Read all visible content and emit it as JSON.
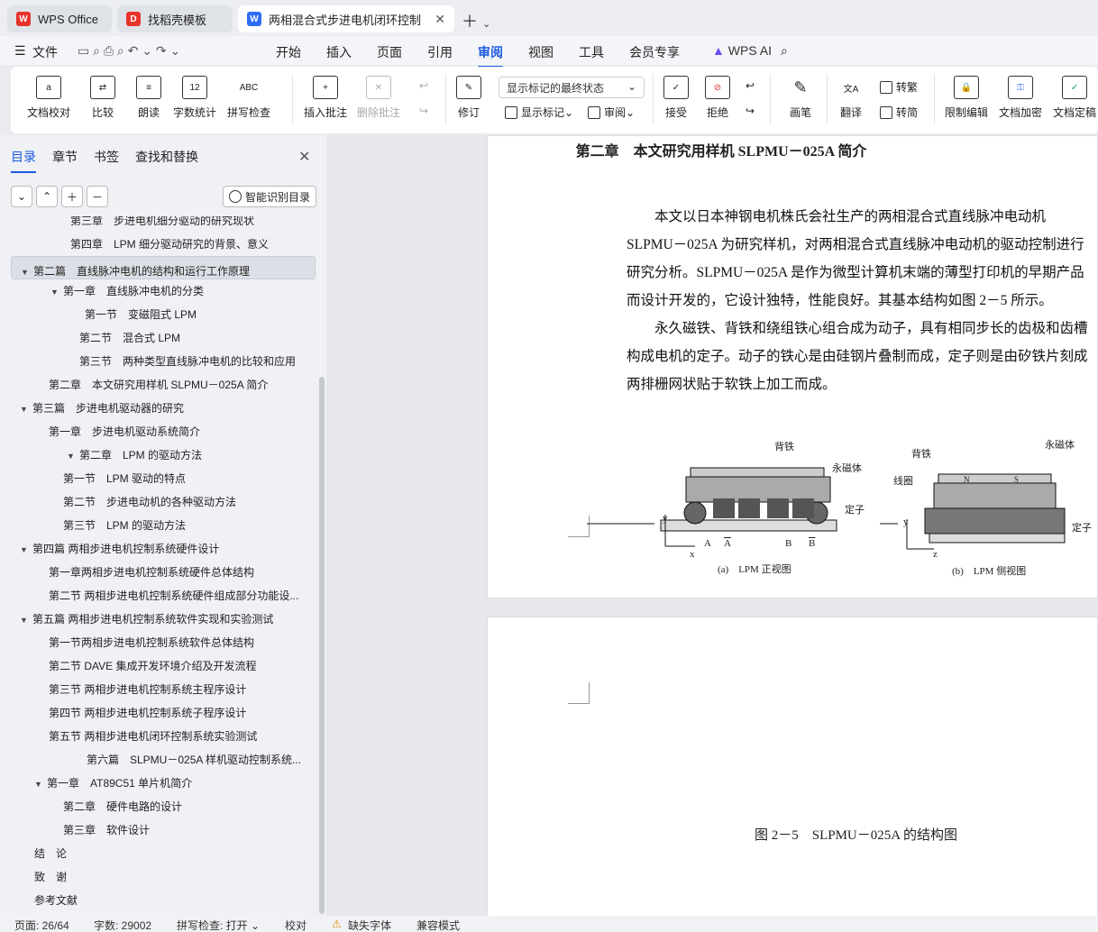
{
  "tabs": [
    {
      "label": "WPS Office",
      "icon": "wps-logo-icon"
    },
    {
      "label": "找稻壳模板",
      "icon": "docer-icon"
    },
    {
      "label": "两相混合式步进电机闭环控制系",
      "icon": "word-doc-icon"
    }
  ],
  "menu": {
    "file": "文件",
    "items": [
      "开始",
      "插入",
      "页面",
      "引用",
      "审阅",
      "视图",
      "工具",
      "会员专享"
    ],
    "active": "审阅",
    "ai": "WPS AI"
  },
  "ribbon": {
    "buttons": [
      "文档校对",
      "比较",
      "朗读",
      "字数统计",
      "拼写检查",
      "插入批注",
      "删除批注",
      "修订",
      "接受",
      "拒绝",
      "画笔",
      "限制编辑",
      "文档加密",
      "文档定稿"
    ],
    "markup_select": "显示标记的最终状态",
    "show_markup": "显示标记",
    "review": "审阅",
    "translate": "翻译",
    "to_traditional": "转繁",
    "to_simplified": "转简",
    "abc": "ABC",
    "count_glyph": "12"
  },
  "sidebar": {
    "tabs": [
      "目录",
      "章节",
      "书签",
      "查找和替换"
    ],
    "smart_label": "智能识别目录",
    "toc": [
      {
        "text": "第三章　步进电机细分驱动的研究现状",
        "indent": 78,
        "arrow": ""
      },
      {
        "text": "第四章　LPM 细分驱动研究的背景、意义",
        "indent": 78,
        "arrow": ""
      },
      {
        "text": "第二篇　直线脉冲电机的结构和运行工作原理",
        "indent": 38,
        "arrow": "▼",
        "selected": true
      },
      {
        "text": "第一章　直线脉冲电机的分类",
        "indent": 72,
        "arrow": "▼"
      },
      {
        "text": "第一节　变磁阻式 LPM",
        "indent": 94,
        "arrow": ""
      },
      {
        "text": "第二节　混合式 LPM",
        "indent": 88,
        "arrow": ""
      },
      {
        "text": "第三节　两种类型直线脉冲电机的比较和应用",
        "indent": 88,
        "arrow": ""
      },
      {
        "text": "第二章　本文研究用样机 SLPMU－025A 简介",
        "indent": 54,
        "arrow": ""
      },
      {
        "text": "第三篇　步进电机驱动器的研究",
        "indent": 38,
        "arrow": "▼"
      },
      {
        "text": "第一章　步进电机驱动系统简介",
        "indent": 54,
        "arrow": ""
      },
      {
        "text": "第二章　LPM 的驱动方法",
        "indent": 90,
        "arrow": "▼"
      },
      {
        "text": "第一节　LPM 驱动的特点",
        "indent": 70,
        "arrow": ""
      },
      {
        "text": "第二节　步进电动机的各种驱动方法",
        "indent": 70,
        "arrow": ""
      },
      {
        "text": "第三节　LPM 的驱动方法",
        "indent": 70,
        "arrow": ""
      },
      {
        "text": "第四篇  两相步进电机控制系统硬件设计",
        "indent": 38,
        "arrow": "▼"
      },
      {
        "text": "第一章两相步进电机控制系统硬件总体结构",
        "indent": 54,
        "arrow": ""
      },
      {
        "text": "第二节  两相步进电机控制系统硬件组成部分功能设...",
        "indent": 54,
        "arrow": ""
      },
      {
        "text": "第五篇  两相步进电机控制系统软件实现和实验测试",
        "indent": 38,
        "arrow": "▼"
      },
      {
        "text": "第一节两相步进电机控制系统软件总体结构",
        "indent": 54,
        "arrow": ""
      },
      {
        "text": "第二节 DAVE  集成开发环境介绍及开发流程",
        "indent": 54,
        "arrow": ""
      },
      {
        "text": "第三节  两相步进电机控制系统主程序设计",
        "indent": 54,
        "arrow": ""
      },
      {
        "text": "第四节  两相步进电机控制系统子程序设计",
        "indent": 54,
        "arrow": ""
      },
      {
        "text": "第五节  两相步进电机闭环控制系统实验测试",
        "indent": 54,
        "arrow": ""
      },
      {
        "text": "第六篇　SLPMU－025A 样机驱动控制系统...",
        "indent": 96,
        "arrow": ""
      },
      {
        "text": "第一章　AT89C51 单片机简介",
        "indent": 54,
        "arrow": "▼"
      },
      {
        "text": "第二章　硬件电路的设计",
        "indent": 70,
        "arrow": ""
      },
      {
        "text": "第三章　软件设计",
        "indent": 70,
        "arrow": ""
      },
      {
        "text": "结　论",
        "indent": 38,
        "arrow": ""
      },
      {
        "text": "致　谢",
        "indent": 38,
        "arrow": ""
      },
      {
        "text": "参考文献",
        "indent": 38,
        "arrow": ""
      }
    ]
  },
  "document": {
    "chapter_title": "第二章　本文研究用样机 SLPMU－025A 简介",
    "para1": "本文以日本神钢电机株氏会社生产的两相混合式直线脉冲电动机 SLPMU－025A 为研究样机，对两相混合式直线脉冲电动机的驱动控制进行研究分析。SLPMU－025A 是作为微型计算机末端的薄型打印机的早期产品而设计开发的，它设计独特，性能良好。其基本结构如图 2－5 所示。",
    "para2": "永久磁铁、背铁和绕组铁心组合成为动子，具有相同步长的齿极和齿槽构成电机的定子。动子的铁心是由硅钢片叠制而成，定子则是由矽铁片刻成两排栅网状贴于软铁上加工而成。",
    "figure": {
      "left_caption": "(a)　LPM 正视图",
      "right_caption": "(b)　LPM 侧视图",
      "labels_left": [
        "背铁",
        "永磁体",
        "定子",
        "y",
        "x",
        "A",
        "A",
        "B",
        "B"
      ],
      "labels_right": [
        "背铁",
        "永磁体",
        "线圈",
        "定子",
        "y",
        "z",
        "N",
        "S"
      ]
    },
    "figure_caption": "图 2－5　SLPMU－025A 的结构图"
  },
  "status": {
    "page": "页面: 26/64",
    "words": "字数: 29002",
    "spell": "拼写检查: 打开",
    "proof": "校对",
    "missing_font": "缺失字体",
    "compat": "兼容模式"
  }
}
